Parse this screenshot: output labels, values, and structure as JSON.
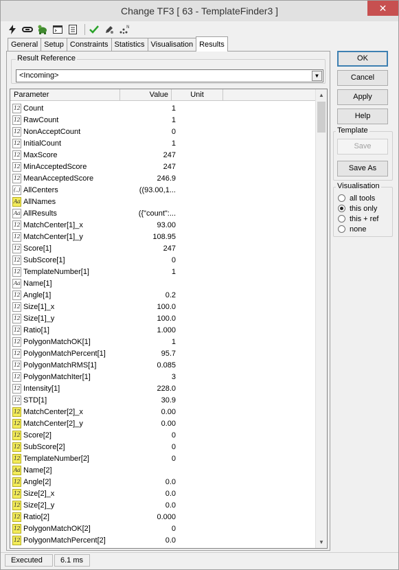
{
  "window": {
    "title": "Change TF3 [ 63 - TemplateFinder3 ]",
    "close_glyph": "✕"
  },
  "toolbar": {
    "icons": [
      "lightning-icon",
      "link-icon",
      "turtle-icon",
      "console-icon",
      "notes-icon",
      "checkmark-icon",
      "edit-icon",
      "magic-icon"
    ]
  },
  "tabs": [
    {
      "label": "General"
    },
    {
      "label": "Setup"
    },
    {
      "label": "Constraints"
    },
    {
      "label": "Statistics"
    },
    {
      "label": "Visualisation"
    },
    {
      "label": "Results",
      "active": true
    }
  ],
  "result_reference": {
    "label": "Result Reference",
    "value": "<Incoming>"
  },
  "grid": {
    "columns": {
      "parameter": "Parameter",
      "value": "Value",
      "unit": "Unit"
    },
    "rows": [
      {
        "icon": "12",
        "yellow": false,
        "name": "Count",
        "value": "1"
      },
      {
        "icon": "12",
        "yellow": false,
        "name": "RawCount",
        "value": "1"
      },
      {
        "icon": "12",
        "yellow": false,
        "name": "NonAcceptCount",
        "value": "0"
      },
      {
        "icon": "12",
        "yellow": false,
        "name": "InitialCount",
        "value": "1"
      },
      {
        "icon": "12",
        "yellow": false,
        "name": "MaxScore",
        "value": "247"
      },
      {
        "icon": "12",
        "yellow": false,
        "name": "MinAcceptedScore",
        "value": "247"
      },
      {
        "icon": "12",
        "yellow": false,
        "name": "MeanAcceptedScore",
        "value": "246.9"
      },
      {
        "icon": "(..)",
        "yellow": false,
        "name": "AllCenters",
        "value": "((93.00,1..."
      },
      {
        "icon": "Aa",
        "yellow": true,
        "name": "AllNames",
        "value": ""
      },
      {
        "icon": "Aa",
        "yellow": false,
        "name": "AllResults",
        "value": "({\"count\":..."
      },
      {
        "icon": "12",
        "yellow": false,
        "name": "MatchCenter[1]_x",
        "value": "93.00"
      },
      {
        "icon": "12",
        "yellow": false,
        "name": "MatchCenter[1]_y",
        "value": "108.95"
      },
      {
        "icon": "12",
        "yellow": false,
        "name": "Score[1]",
        "value": "247"
      },
      {
        "icon": "12",
        "yellow": false,
        "name": "SubScore[1]",
        "value": "0"
      },
      {
        "icon": "12",
        "yellow": false,
        "name": "TemplateNumber[1]",
        "value": "1"
      },
      {
        "icon": "Aa",
        "yellow": false,
        "name": "Name[1]",
        "value": ""
      },
      {
        "icon": "12",
        "yellow": false,
        "name": "Angle[1]",
        "value": "0.2"
      },
      {
        "icon": "12",
        "yellow": false,
        "name": "Size[1]_x",
        "value": "100.0"
      },
      {
        "icon": "12",
        "yellow": false,
        "name": "Size[1]_y",
        "value": "100.0"
      },
      {
        "icon": "12",
        "yellow": false,
        "name": "Ratio[1]",
        "value": "1.000"
      },
      {
        "icon": "12",
        "yellow": false,
        "name": "PolygonMatchOK[1]",
        "value": "1"
      },
      {
        "icon": "12",
        "yellow": false,
        "name": "PolygonMatchPercent[1]",
        "value": "95.7"
      },
      {
        "icon": "12",
        "yellow": false,
        "name": "PolygonMatchRMS[1]",
        "value": "0.085"
      },
      {
        "icon": "12",
        "yellow": false,
        "name": "PolygonMatchIter[1]",
        "value": "3"
      },
      {
        "icon": "12",
        "yellow": false,
        "name": "Intensity[1]",
        "value": "228.0"
      },
      {
        "icon": "12",
        "yellow": false,
        "name": "STD[1]",
        "value": "30.9"
      },
      {
        "icon": "12",
        "yellow": true,
        "name": "MatchCenter[2]_x",
        "value": "0.00"
      },
      {
        "icon": "12",
        "yellow": true,
        "name": "MatchCenter[2]_y",
        "value": "0.00"
      },
      {
        "icon": "12",
        "yellow": true,
        "name": "Score[2]",
        "value": "0"
      },
      {
        "icon": "12",
        "yellow": true,
        "name": "SubScore[2]",
        "value": "0"
      },
      {
        "icon": "12",
        "yellow": true,
        "name": "TemplateNumber[2]",
        "value": "0"
      },
      {
        "icon": "Aa",
        "yellow": true,
        "name": "Name[2]",
        "value": ""
      },
      {
        "icon": "12",
        "yellow": true,
        "name": "Angle[2]",
        "value": "0.0"
      },
      {
        "icon": "12",
        "yellow": true,
        "name": "Size[2]_x",
        "value": "0.0"
      },
      {
        "icon": "12",
        "yellow": true,
        "name": "Size[2]_y",
        "value": "0.0"
      },
      {
        "icon": "12",
        "yellow": true,
        "name": "Ratio[2]",
        "value": "0.000"
      },
      {
        "icon": "12",
        "yellow": true,
        "name": "PolygonMatchOK[2]",
        "value": "0"
      },
      {
        "icon": "12",
        "yellow": true,
        "name": "PolygonMatchPercent[2]",
        "value": "0.0"
      }
    ]
  },
  "buttons": {
    "ok": "OK",
    "cancel": "Cancel",
    "apply": "Apply",
    "help": "Help"
  },
  "template_group": {
    "label": "Template",
    "save": "Save",
    "save_as": "Save As"
  },
  "visualisation_group": {
    "label": "Visualisation",
    "options": [
      {
        "label": "all tools",
        "checked": false
      },
      {
        "label": "this only",
        "checked": true
      },
      {
        "label": "this + ref",
        "checked": false
      },
      {
        "label": "none",
        "checked": false
      }
    ]
  },
  "status": {
    "state": "Executed",
    "time": "6.1 ms"
  }
}
